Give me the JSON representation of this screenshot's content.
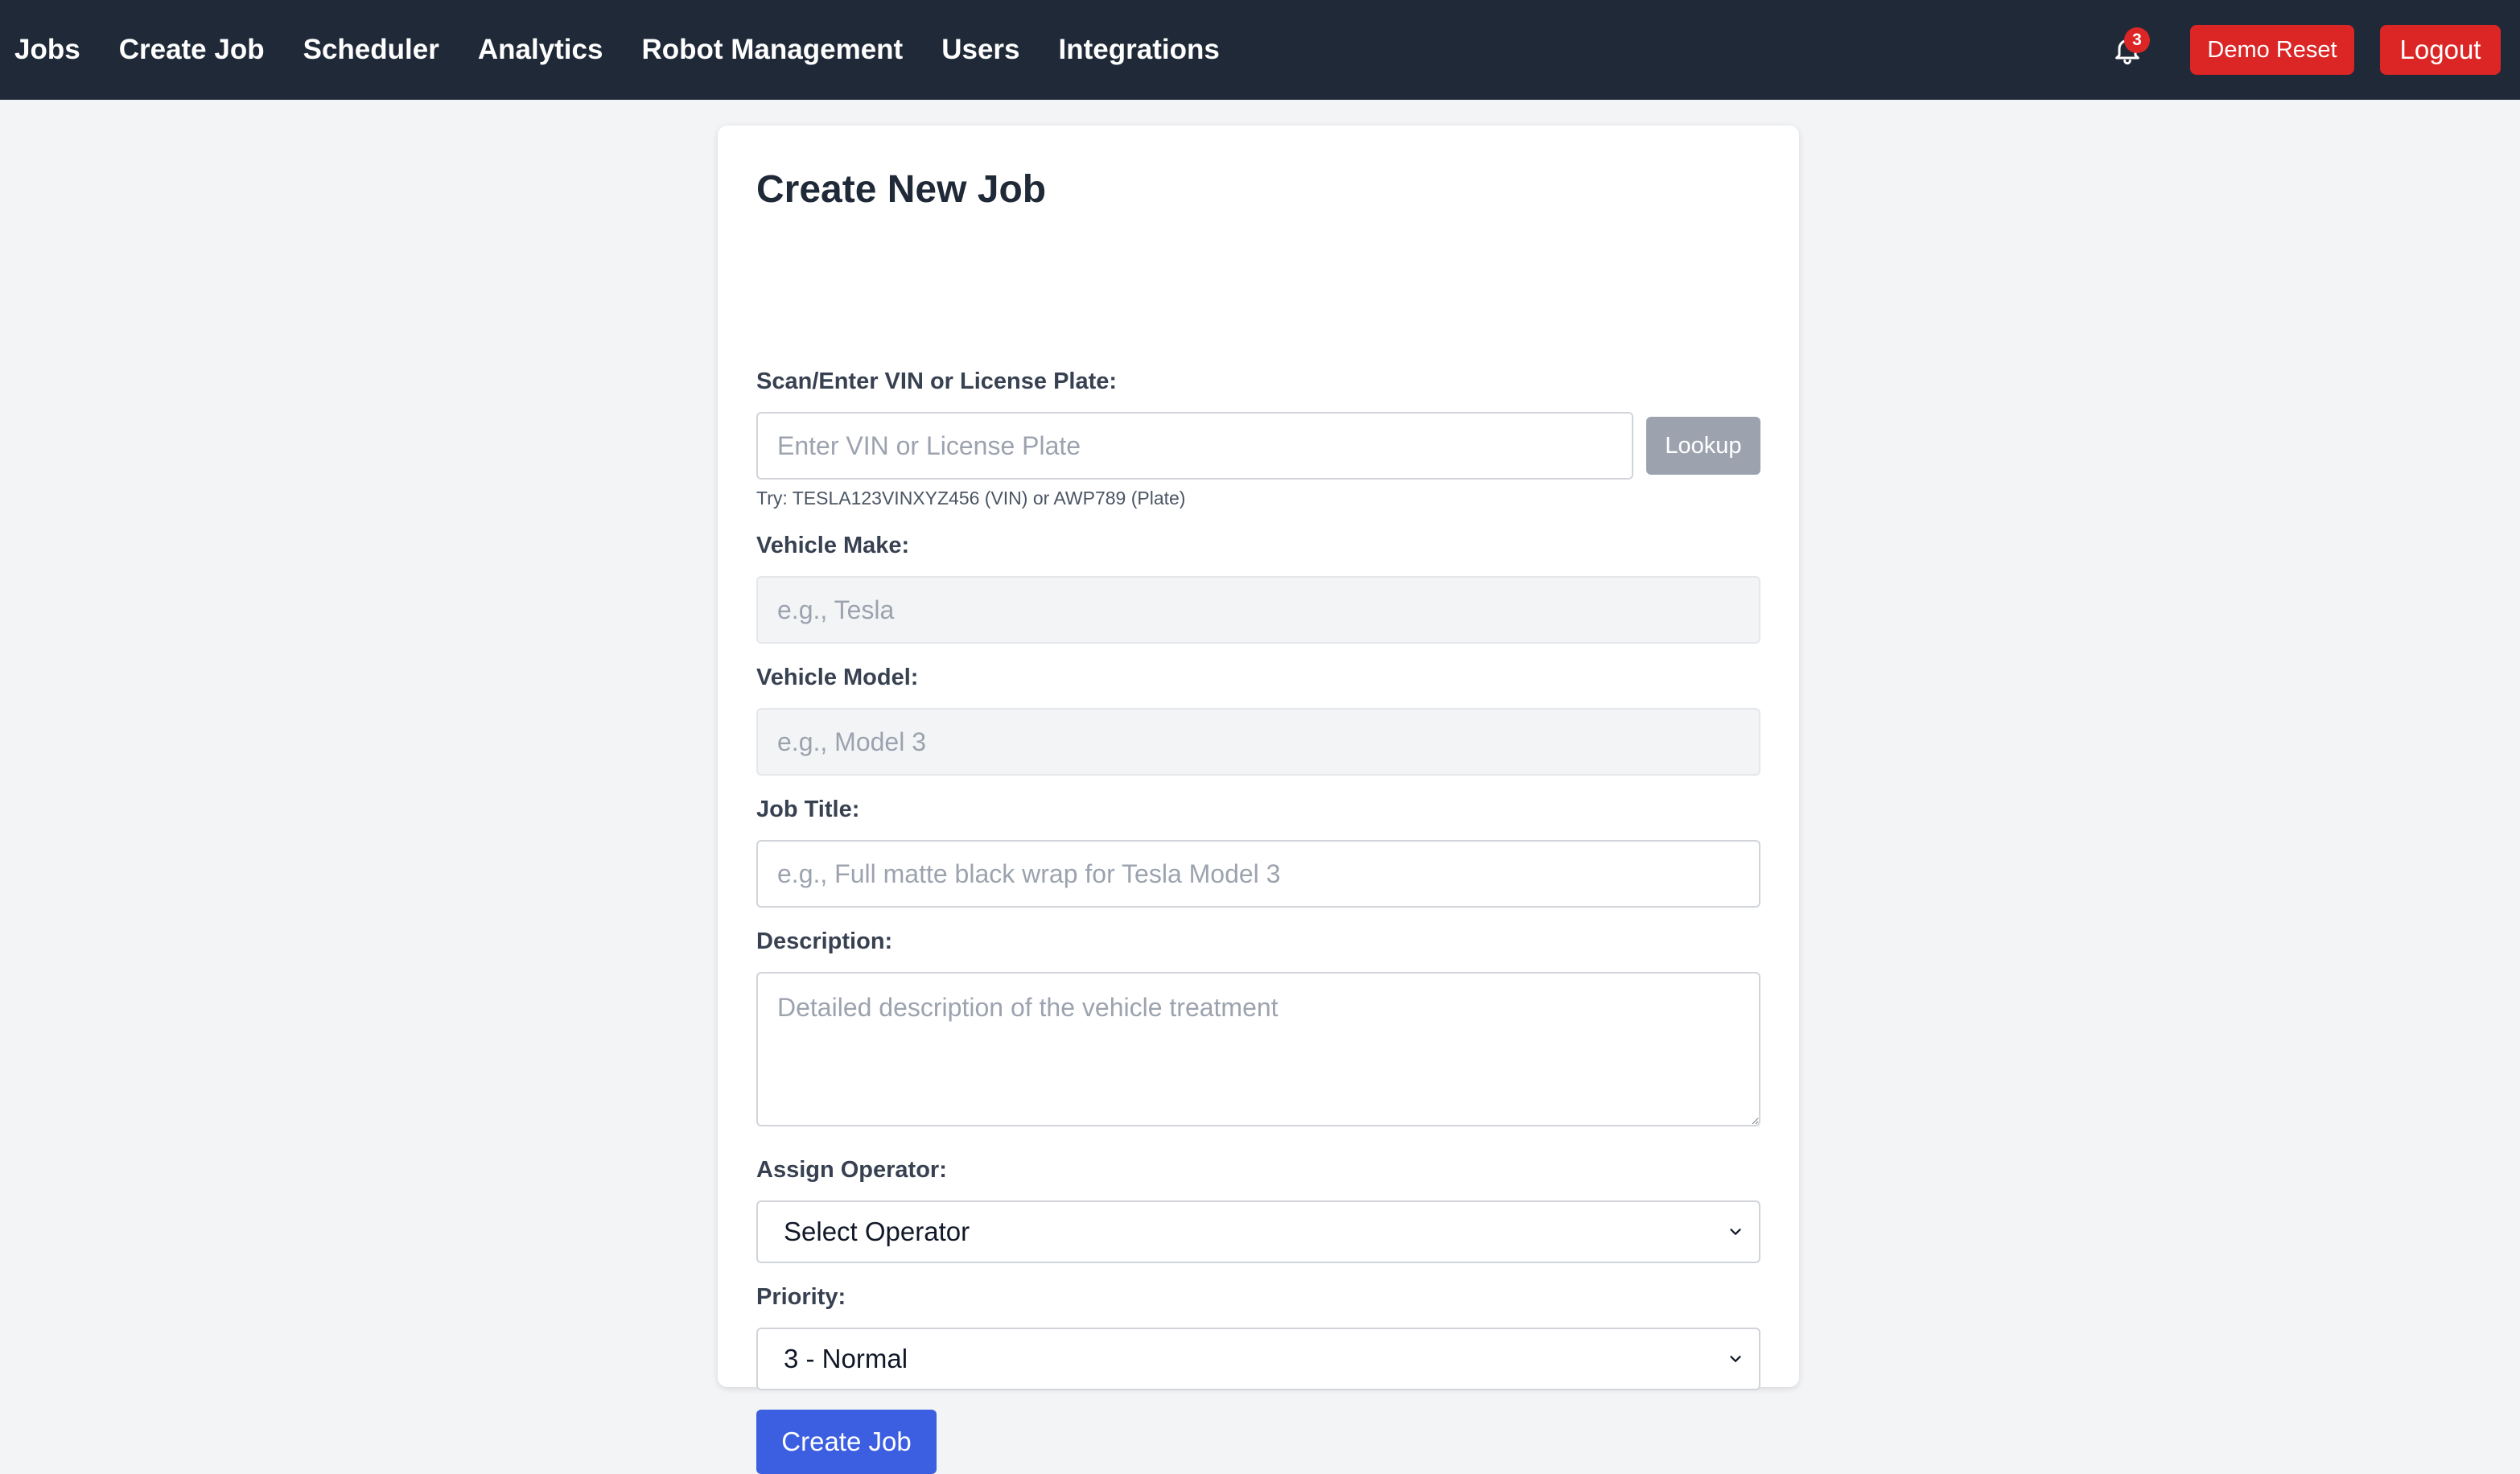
{
  "nav": {
    "links": [
      "Jobs",
      "Create Job",
      "Scheduler",
      "Analytics",
      "Robot Management",
      "Users",
      "Integrations"
    ],
    "notification_count": "3",
    "demo_reset_label": "Demo Reset",
    "logout_label": "Logout"
  },
  "form": {
    "title": "Create New Job",
    "vin": {
      "label": "Scan/Enter VIN or License Plate:",
      "placeholder": "Enter VIN or License Plate",
      "lookup_label": "Lookup",
      "hint": "Try: TESLA123VINXYZ456 (VIN) or AWP789 (Plate)"
    },
    "make": {
      "label": "Vehicle Make:",
      "placeholder": "e.g., Tesla"
    },
    "model": {
      "label": "Vehicle Model:",
      "placeholder": "e.g., Model 3"
    },
    "job_title": {
      "label": "Job Title:",
      "placeholder": "e.g., Full matte black wrap for Tesla Model 3"
    },
    "description": {
      "label": "Description:",
      "placeholder": "Detailed description of the vehicle treatment"
    },
    "operator": {
      "label": "Assign Operator:",
      "selected": "Select Operator"
    },
    "priority": {
      "label": "Priority:",
      "selected": "3 - Normal"
    },
    "submit_label": "Create Job"
  },
  "colors": {
    "navbar": "#1f2937",
    "danger": "#dc2626",
    "primary": "#3b5fe0",
    "lookup_disabled": "#9ca3af",
    "page_bg": "#f3f4f6"
  }
}
